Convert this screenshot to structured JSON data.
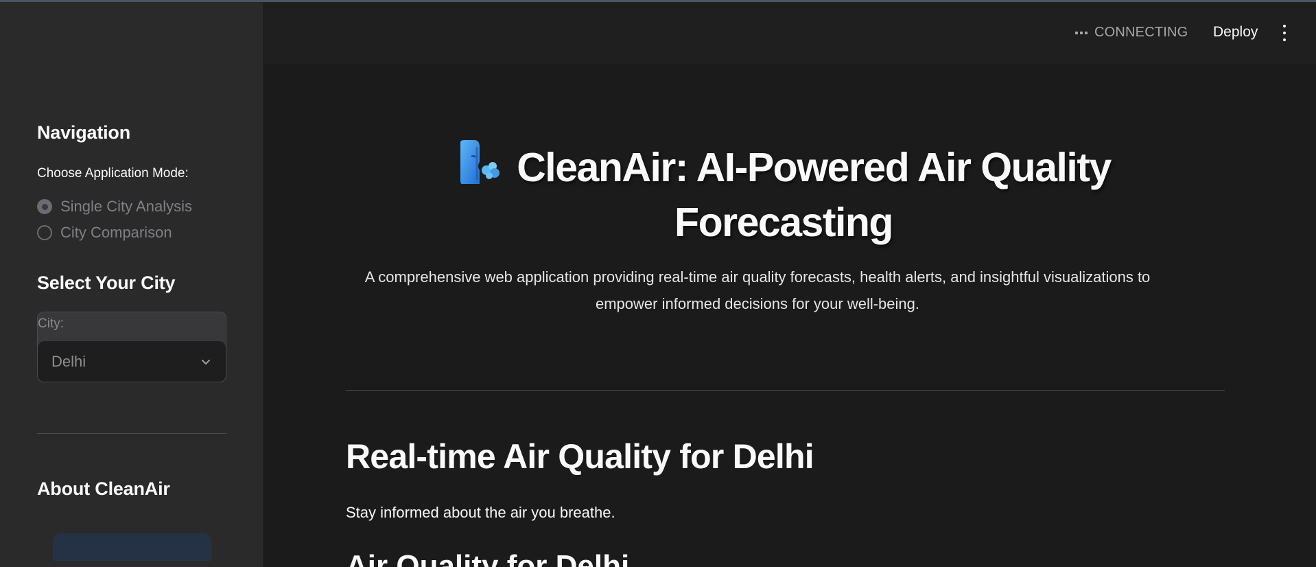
{
  "header": {
    "status": "CONNECTING",
    "deploy_label": "Deploy",
    "menu_icon": "kebab-menu-icon"
  },
  "sidebar": {
    "navigation_heading": "Navigation",
    "mode_label": "Choose Application Mode:",
    "modes": [
      {
        "label": "Single City Analysis",
        "selected": true
      },
      {
        "label": "City Comparison",
        "selected": false
      }
    ],
    "city_heading": "Select Your City",
    "city_label": "City:",
    "city_value": "Delhi",
    "about_heading": "About CleanAir"
  },
  "main": {
    "title_icon": "face-exhaling-icon",
    "title": "CleanAir: AI-Powered Air Quality Forecasting",
    "description": "A comprehensive web application providing real-time air quality forecasts, health alerts, and insightful visualizations to empower informed decisions for your well-being.",
    "section_title": "Real-time Air Quality for Delhi",
    "section_subtitle": "Stay informed about the air you breathe.",
    "next_heading_partial": "Air Quality for Delhi"
  },
  "colors": {
    "background": "#1b1b1b",
    "sidebar": "#2a2a2b",
    "text": "#fafafa",
    "muted": "#808085"
  }
}
